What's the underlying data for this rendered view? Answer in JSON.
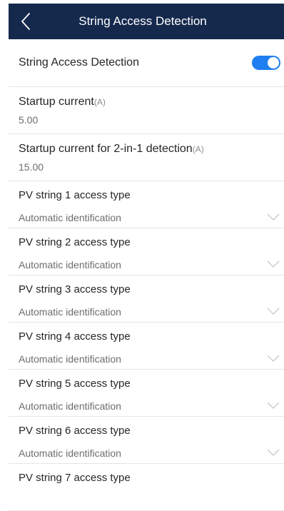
{
  "header": {
    "title": "String Access Detection",
    "back_icon": "back-arrow-icon"
  },
  "colors": {
    "header_bg": "#15294d",
    "toggle_on": "#1f7ff0"
  },
  "detection": {
    "label": "String Access Detection",
    "enabled": true
  },
  "fields": [
    {
      "label": "Startup current",
      "unit": "(A)",
      "value": "5.00"
    },
    {
      "label": "Startup current for 2-in-1 detection",
      "unit": "(A)",
      "value": "15.00"
    }
  ],
  "strings": [
    {
      "label": "PV string 1 access type",
      "value": "Automatic identification"
    },
    {
      "label": "PV string 2 access type",
      "value": "Automatic identification"
    },
    {
      "label": "PV string 3 access type",
      "value": "Automatic identification"
    },
    {
      "label": "PV string 4 access type",
      "value": "Automatic identification"
    },
    {
      "label": "PV string 5 access type",
      "value": "Automatic identification"
    },
    {
      "label": "PV string 6 access type",
      "value": "Automatic identification"
    },
    {
      "label": "PV string 7 access type",
      "value": ""
    }
  ]
}
